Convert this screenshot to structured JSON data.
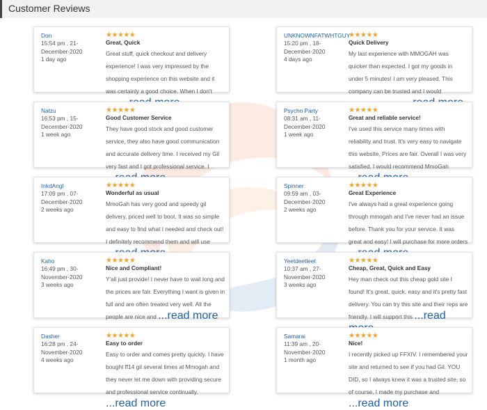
{
  "header": {
    "title": "Customer Reviews"
  },
  "rating_stars": "★★★★★",
  "reviews": [
    {
      "name": "Don",
      "time": "15:54 pm , 21-December-2020",
      "ago": "1 day ago",
      "title": "Great, Quick",
      "body": "Great stuff, quick checkout and delivery experience! I was very impressed by the shopping experience on this website and it was certainly a good choice. When I don't have",
      "more": "...read more"
    },
    {
      "name": "UNKNOWNFATWHTGUY",
      "time": "15:20 pm , 18-December-2020",
      "ago": "4 days ago",
      "title": "Quick Delivery",
      "body": "My last experience with MMOGAH was quicker than expected. I got my goods in under 5 minutes! I am very pleased. This company can be trusted and I would recommend ordering",
      "more": "...read more"
    },
    {
      "name": "Natzu",
      "time": "16:53 pm , 15-December-2020",
      "ago": "1 week ago",
      "title": "Good Customer Service",
      "body": "They have good stock and good customer service, they also have good communication and accurate delivery time. I received my Gil very fast and I got professional service. I",
      "more": "...read more"
    },
    {
      "name": "Psycho Party",
      "time": "08:31 am , 11-December-2020",
      "ago": "1 week ago",
      "title": "Great and reliable service!",
      "body": "I've used this service many times with reliability and trust. It's very easy to navigate this website, Prices are fair. Overall I was very satisfied. I would recommend MmoGah",
      "more": "...read more"
    },
    {
      "name": "InkdAngl",
      "time": "17:09 pm , 07-December-2020",
      "ago": "2 weeks ago",
      "title": "Wonderful as usual",
      "body": "MmoGah has very good and speedy gil delivery, priced well to boot. It was so simple and easy to find what I needed and check out! I definitely recommend them and will use",
      "more": "...read more"
    },
    {
      "name": "Spinner",
      "time": "09:59 am , 03-December-2020",
      "ago": "2 weeks ago",
      "title": "Great Experience",
      "body": "I've always had a great experience going through mmogah and I've never had an issue before. Thank you for your service. It was great and easy! I will purchase for more orders",
      "more": "...read more"
    },
    {
      "name": "Kaho",
      "time": "16:49 pm , 30-November-2020",
      "ago": "3 weeks ago",
      "title": "Nice and Compliant!",
      "body": "Y'all just provide! I never have to wait long and the prices are fair. Everything I want is given in full and are often treated very well. All the people are nice and",
      "more": "...read more"
    },
    {
      "name": "Yeetdeetleet",
      "time": "10:37 am , 27-November-2020",
      "ago": "3 weeks ago",
      "title": "Cheap, Great, Quick and Easy",
      "body": "Hey man check out this cheap gold site I found! It's great, quick, easy and it's pretty fast delivery. You can try this site and their reps are friendly. I will support this",
      "more": "...read more"
    },
    {
      "name": "Dasher",
      "time": "16:28 pm , 24-November-2020",
      "ago": "4 weeks ago",
      "title": "Easy to order",
      "body": "Easy to order and comes pretty quickly. I have bought ff14 gil several times at Mmogah and they never let me down with providing secure and professional service continually.",
      "more": "...read more"
    },
    {
      "name": "Samarai",
      "time": "11:39 am , 20-November-2020",
      "ago": "1 month ago",
      "title": "Nice!",
      "body": "I recently picked up FFXIV. I remembered your site and returned to see if you had Gil. YOU DID, so I always knew it was a trusted site, so of course, I made my purchase and",
      "more": "...read more"
    }
  ]
}
